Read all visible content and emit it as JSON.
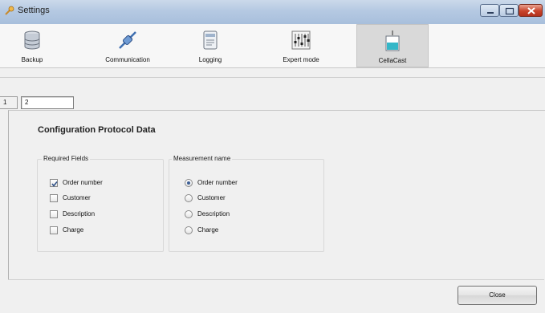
{
  "window": {
    "title": "Settings"
  },
  "toolbar": {
    "items": [
      {
        "label": "Backup",
        "icon": "database-icon"
      },
      {
        "label": "Communication",
        "icon": "network-plug-icon"
      },
      {
        "label": "Logging",
        "icon": "log-document-icon"
      },
      {
        "label": "Expert mode",
        "icon": "sliders-icon"
      },
      {
        "label": "CellaCast",
        "icon": "beaker-icon",
        "selected": true
      }
    ]
  },
  "tabs": [
    {
      "label": "1"
    },
    {
      "label": "2",
      "active": true
    }
  ],
  "main": {
    "heading": "Configuration Protocol Data",
    "required_fields": {
      "title": "Required Fields",
      "items": [
        {
          "label": "Order number",
          "checked": true
        },
        {
          "label": "Customer",
          "checked": false
        },
        {
          "label": "Description",
          "checked": false
        },
        {
          "label": "Charge",
          "checked": false
        }
      ]
    },
    "measurement_name": {
      "title": "Measurement name",
      "items": [
        {
          "label": "Order number",
          "selected": true
        },
        {
          "label": "Customer",
          "selected": false
        },
        {
          "label": "Description",
          "selected": false
        },
        {
          "label": "Charge",
          "selected": false
        }
      ]
    }
  },
  "footer": {
    "close_label": "Close"
  }
}
